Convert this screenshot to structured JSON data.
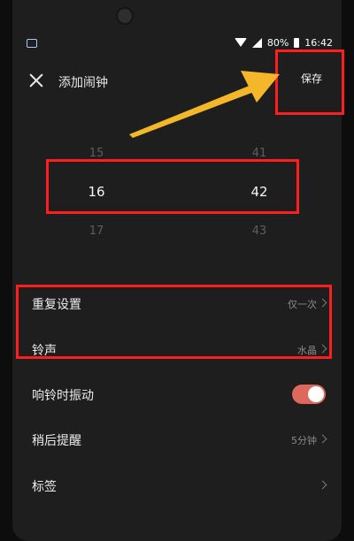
{
  "status_bar": {
    "battery": "80%",
    "time": "16:42"
  },
  "header": {
    "title": "添加闹钟",
    "save_label": "保存"
  },
  "time_picker": {
    "hours": {
      "prev": "15",
      "selected": "16",
      "next": "17"
    },
    "minutes": {
      "prev": "41",
      "selected": "42",
      "next": "43"
    }
  },
  "settings": {
    "repeat": {
      "label": "重复设置",
      "value": "仅一次"
    },
    "ringtone": {
      "label": "铃声",
      "value": "水晶"
    },
    "vibrate": {
      "label": "响铃时振动",
      "on": true
    },
    "snooze": {
      "label": "稍后提醒",
      "value": "5分钟"
    },
    "tag": {
      "label": "标签"
    }
  },
  "colors": {
    "highlight": "#ff1e1e",
    "arrow": "#f4b72a",
    "toggle_on": "#e0675c"
  }
}
